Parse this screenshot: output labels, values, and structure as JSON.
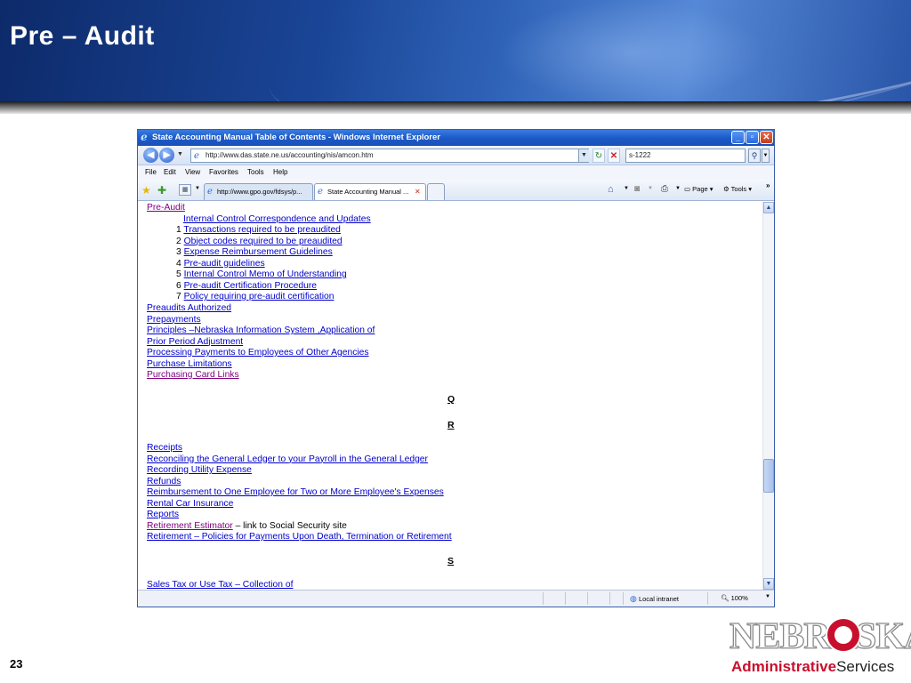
{
  "slide": {
    "title": "Pre – Audit",
    "page_number": "23",
    "logo": {
      "word": "NEBRASKA",
      "tagline_admin": "Administrative",
      "tagline_services": "Services"
    }
  },
  "browser": {
    "window_title": "State Accounting Manual Table of Contents - Windows Internet Explorer",
    "url": "http://www.das.state.ne.us/accounting/nis/amcon.htm",
    "search_value": "s-1222",
    "menu": [
      "File",
      "Edit",
      "View",
      "Favorites",
      "Tools",
      "Help"
    ],
    "tabs": [
      {
        "label": "http://www.gpo.gov/fdsys/p..."
      },
      {
        "label": "State Accounting Manual ..."
      }
    ],
    "command": {
      "page": "Page",
      "tools": "Tools"
    },
    "status": {
      "zone": "Local intranet",
      "zoom": "100%"
    }
  },
  "content": {
    "preaudit_heading": "Pre-Audit",
    "icc_link": "Internal Control Correspondence and Updates",
    "numbered": [
      {
        "num": "1",
        "text": "Transactions required to be preaudited"
      },
      {
        "num": "2",
        "text": "Object codes required to be preaudited"
      },
      {
        "num": "3",
        "text": "Expense Reimbursement Guidelines"
      },
      {
        "num": "4",
        "text": "Pre-audit guidelines"
      },
      {
        "num": "5",
        "text": "Internal Control Memo of Understanding"
      },
      {
        "num": "6",
        "text": "Pre-audit Certification Procedure"
      },
      {
        "num": "7",
        "text": "Policy requiring pre-audit certification"
      }
    ],
    "p_links": [
      "Preaudits Authorized",
      "Prepayments",
      "Principles –Nebraska Information System ,Application of",
      "Prior Period Adjustment",
      "Processing Payments to Employees of Other Agencies",
      "Purchase Limitations",
      "Purchasing Card Links"
    ],
    "letter_q": "Q",
    "letter_r": "R",
    "r_links": [
      "Receipts",
      "Reconciling the General Ledger to your Payroll in the General Ledger",
      "Recording Utility Expense",
      "Refunds",
      "Reimbursement to One Employee for Two or More Employee's Expenses",
      "Rental Car Insurance",
      "Reports"
    ],
    "retirement_estimator": "Retirement Estimator",
    "retirement_estimator_note": " – link to Social Security site",
    "retirement_policies": "Retirement – Policies for Payments Upon Death, Termination or Retirement",
    "letter_s": "S",
    "sales_tax": "Sales Tax or Use Tax – Collection of"
  }
}
